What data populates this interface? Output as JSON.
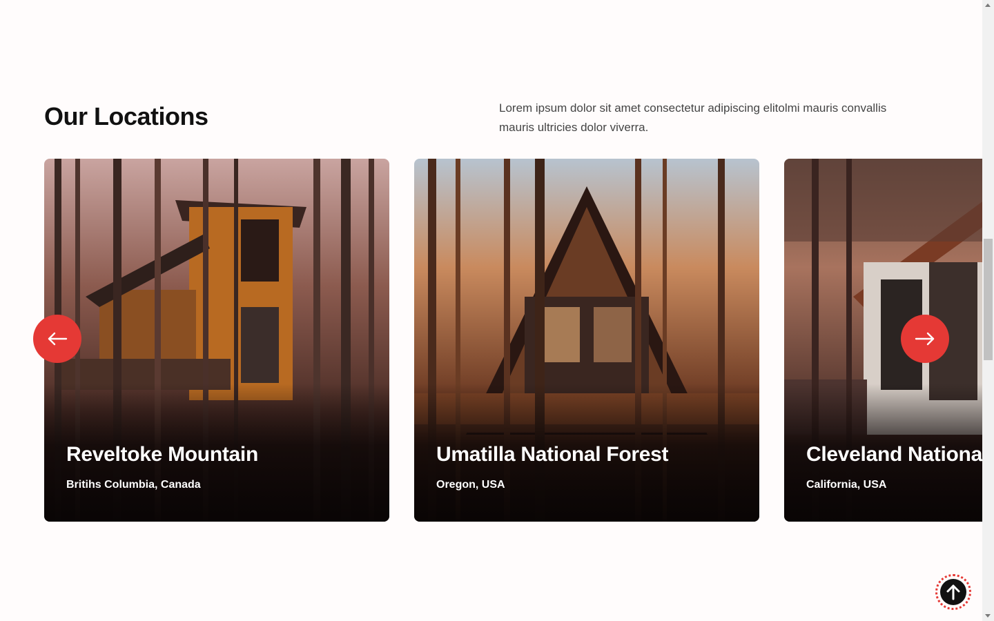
{
  "section": {
    "title": "Our Locations",
    "description": "Lorem ipsum dolor sit amet consectetur adipiscing elitolmi mauris convallis mauris ultricies dolor viverra."
  },
  "locations": [
    {
      "name": "Reveltoke Mountain",
      "region": "Britihs Columbia, Canada"
    },
    {
      "name": "Umatilla National Forest",
      "region": "Oregon, USA"
    },
    {
      "name": "Cleveland National Forest",
      "region": "California, USA"
    }
  ],
  "carousel": {
    "prev_icon": "arrow-left-icon",
    "next_icon": "arrow-right-icon"
  },
  "scroll_to_top_icon": "arrow-up-icon",
  "colors": {
    "accent": "#e53935",
    "heading": "#111111",
    "body_text": "#444444",
    "page_background": "#fffcfc"
  }
}
